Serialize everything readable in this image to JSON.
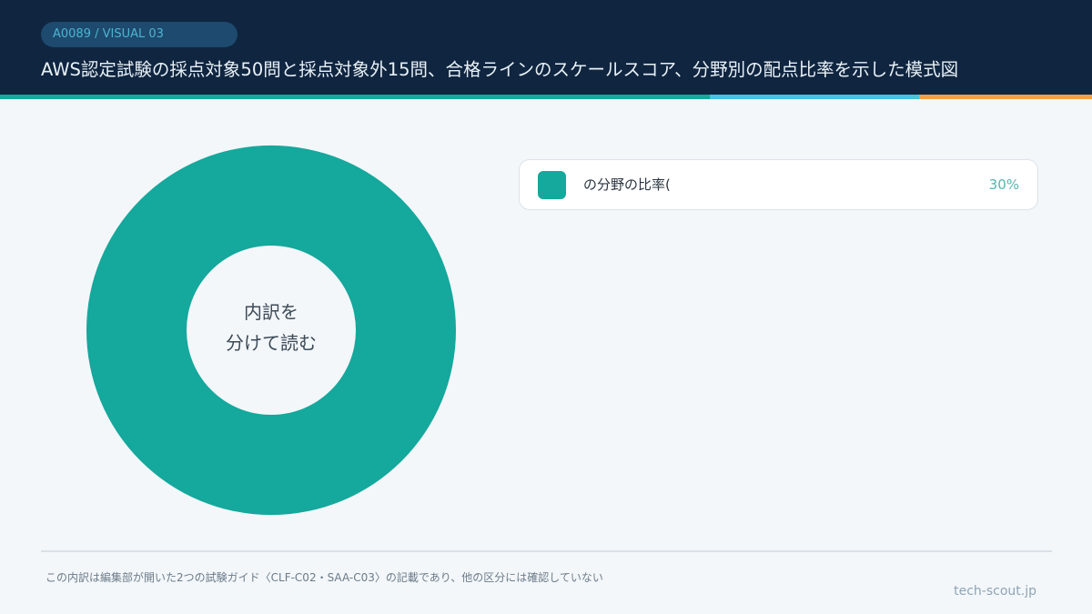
{
  "header": {
    "code": "A0089 / VISUAL 03",
    "title": "AWS認定試験の採点対象50問と採点対象外15問、合格ラインのスケールスコア、分野別の配点比率を示した模式図"
  },
  "colors": {
    "header_bg": "#0f2540",
    "accent_teal": "#15a89c",
    "accent_cyan": "#45c3df",
    "accent_orange": "#f0a145",
    "donut": "#15a89c"
  },
  "chart_data": {
    "type": "pie",
    "center_label": [
      "内訳を",
      "分けて読む"
    ],
    "slices": [
      {
        "label": "の分野の比率(",
        "value": 30,
        "value_label": "30%",
        "color": "#15a89c"
      }
    ],
    "legend_placement": "right"
  },
  "footer": {
    "note": "この内訳は編集部が開いた2つの試験ガイド〈CLF-C02・SAA-C03〉の記載であり、他の区分には確認していない",
    "source": "tech-scout.jp"
  }
}
